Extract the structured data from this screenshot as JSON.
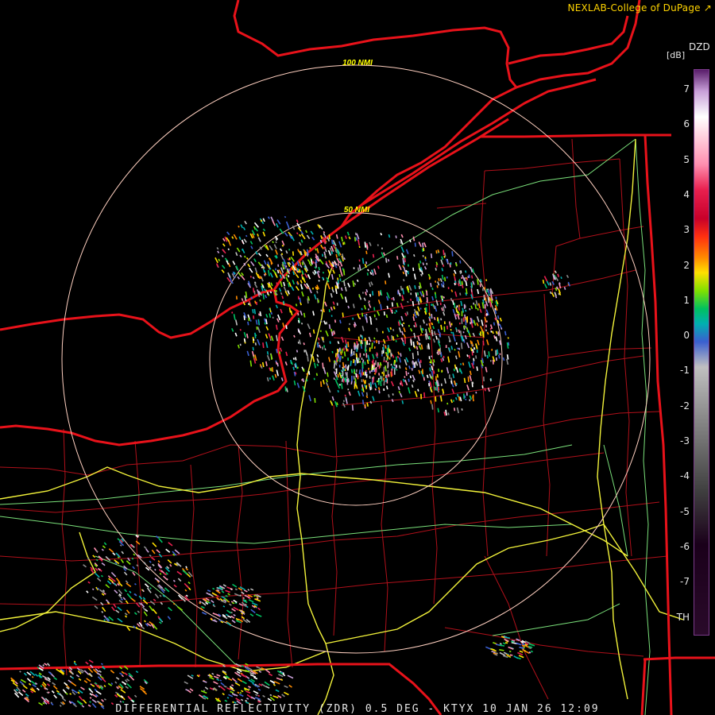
{
  "header": {
    "credit": "NEXLAB-College of DuPage ↗"
  },
  "footer": {
    "caption": "DIFFERENTIAL REFLECTIVITY (ZDR) 0.5 DEG - KTYX 10 JAN 26 12:09"
  },
  "range_rings": {
    "inner_label": "50 NMI",
    "outer_label": "100 NMI"
  },
  "color_scale": {
    "title": "DZD",
    "unit": "[dB]",
    "ticks": [
      "7",
      "6",
      "5",
      "4",
      "3",
      "2",
      "1",
      "0",
      "-1",
      "-2",
      "-3",
      "-4",
      "-5",
      "-6",
      "-7",
      "TH"
    ],
    "stops": [
      {
        "v": 7.6,
        "c": "#5a1d6b"
      },
      {
        "v": 7.0,
        "c": "#c8a0d8"
      },
      {
        "v": 6.3,
        "c": "#ffffff"
      },
      {
        "v": 5.0,
        "c": "#ff8fb0"
      },
      {
        "v": 4.3,
        "c": "#e8204f"
      },
      {
        "v": 3.5,
        "c": "#c8002a"
      },
      {
        "v": 3.0,
        "c": "#ff3010"
      },
      {
        "v": 2.4,
        "c": "#ff8c00"
      },
      {
        "v": 2.0,
        "c": "#ffe000"
      },
      {
        "v": 1.5,
        "c": "#80e000"
      },
      {
        "v": 1.0,
        "c": "#00c060"
      },
      {
        "v": 0.6,
        "c": "#00b0b0"
      },
      {
        "v": 0.1,
        "c": "#3a5fd0"
      },
      {
        "v": -0.6,
        "c": "#c0c0c0"
      },
      {
        "v": -2.0,
        "c": "#8a8a8a"
      },
      {
        "v": -4.0,
        "c": "#404040"
      },
      {
        "v": -5.5,
        "c": "#1a001a"
      },
      {
        "v": -8.0,
        "c": "#2a0a2a"
      }
    ]
  },
  "colors": {
    "state_border": "#e8121a",
    "county_border": "#b0101a",
    "interstate": "#f2f23a",
    "highway": "#7ae07a",
    "range_ring": "#ffd0c0",
    "ring_label": "#ffff00"
  }
}
